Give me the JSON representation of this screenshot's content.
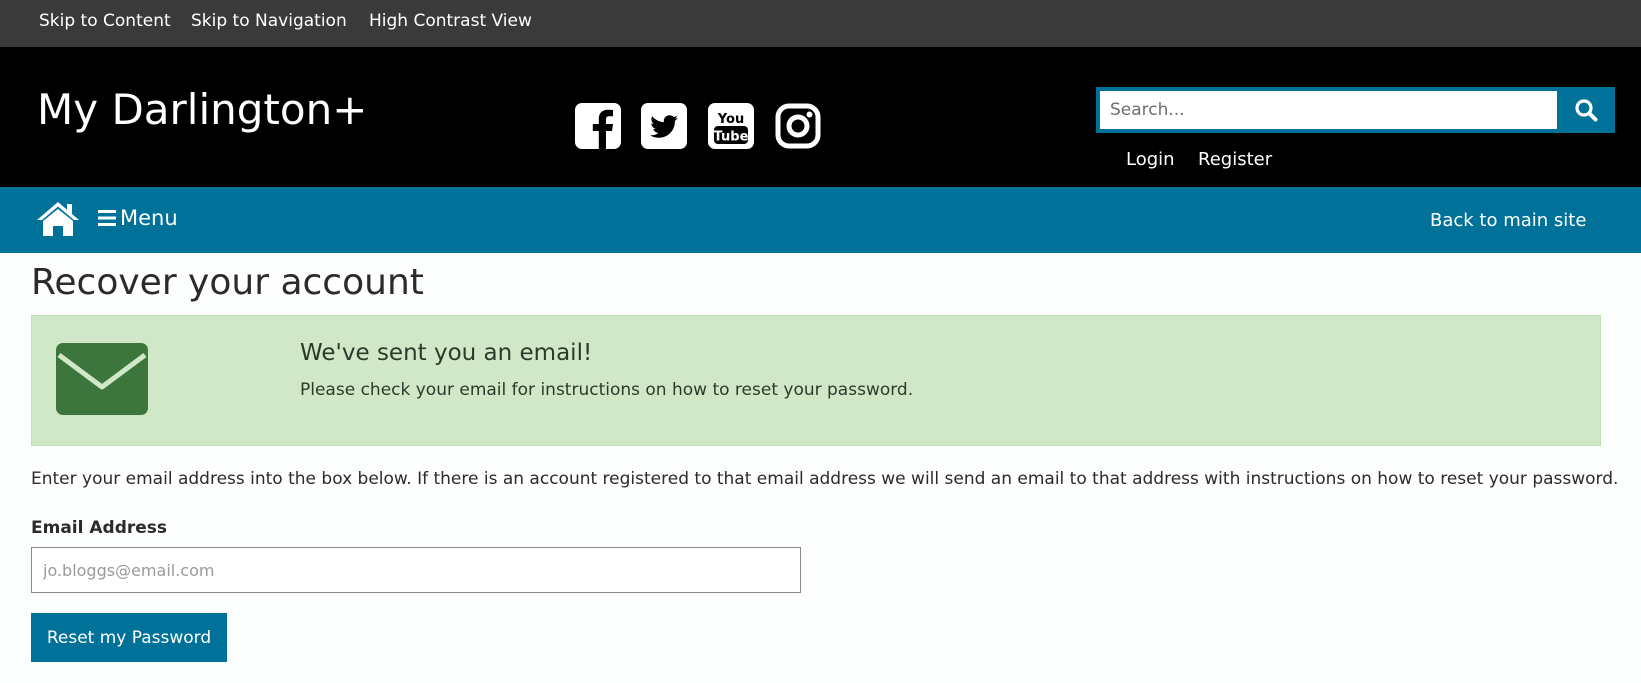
{
  "skip_links": {
    "content": "Skip to Content",
    "navigation": "Skip to Navigation",
    "contrast": "High Contrast View"
  },
  "header": {
    "site_name": "My Darlington+",
    "social": [
      "facebook-icon",
      "twitter-icon",
      "youtube-icon",
      "instagram-icon"
    ],
    "search": {
      "placeholder": "Search..."
    },
    "login": "Login",
    "register": "Register"
  },
  "nav": {
    "menu_label": "Menu",
    "back_label": "Back to main site"
  },
  "page": {
    "title": "Recover your account",
    "alert": {
      "heading": "We've sent you an email!",
      "text": "Please check your email for instructions on how to reset your password."
    },
    "intro": "Enter your email address into the box below. If there is an account registered to that email address we will send an email to that address with instructions on how to reset your password.",
    "email_label": "Email Address",
    "email_placeholder": "jo.bloggs@email.com",
    "submit_label": "Reset my Password"
  },
  "colors": {
    "topbar": "#3a3a3a",
    "header": "#000000",
    "accent": "#00729a",
    "alert_bg": "#d0e8c8",
    "mail_icon": "#3c763d"
  }
}
